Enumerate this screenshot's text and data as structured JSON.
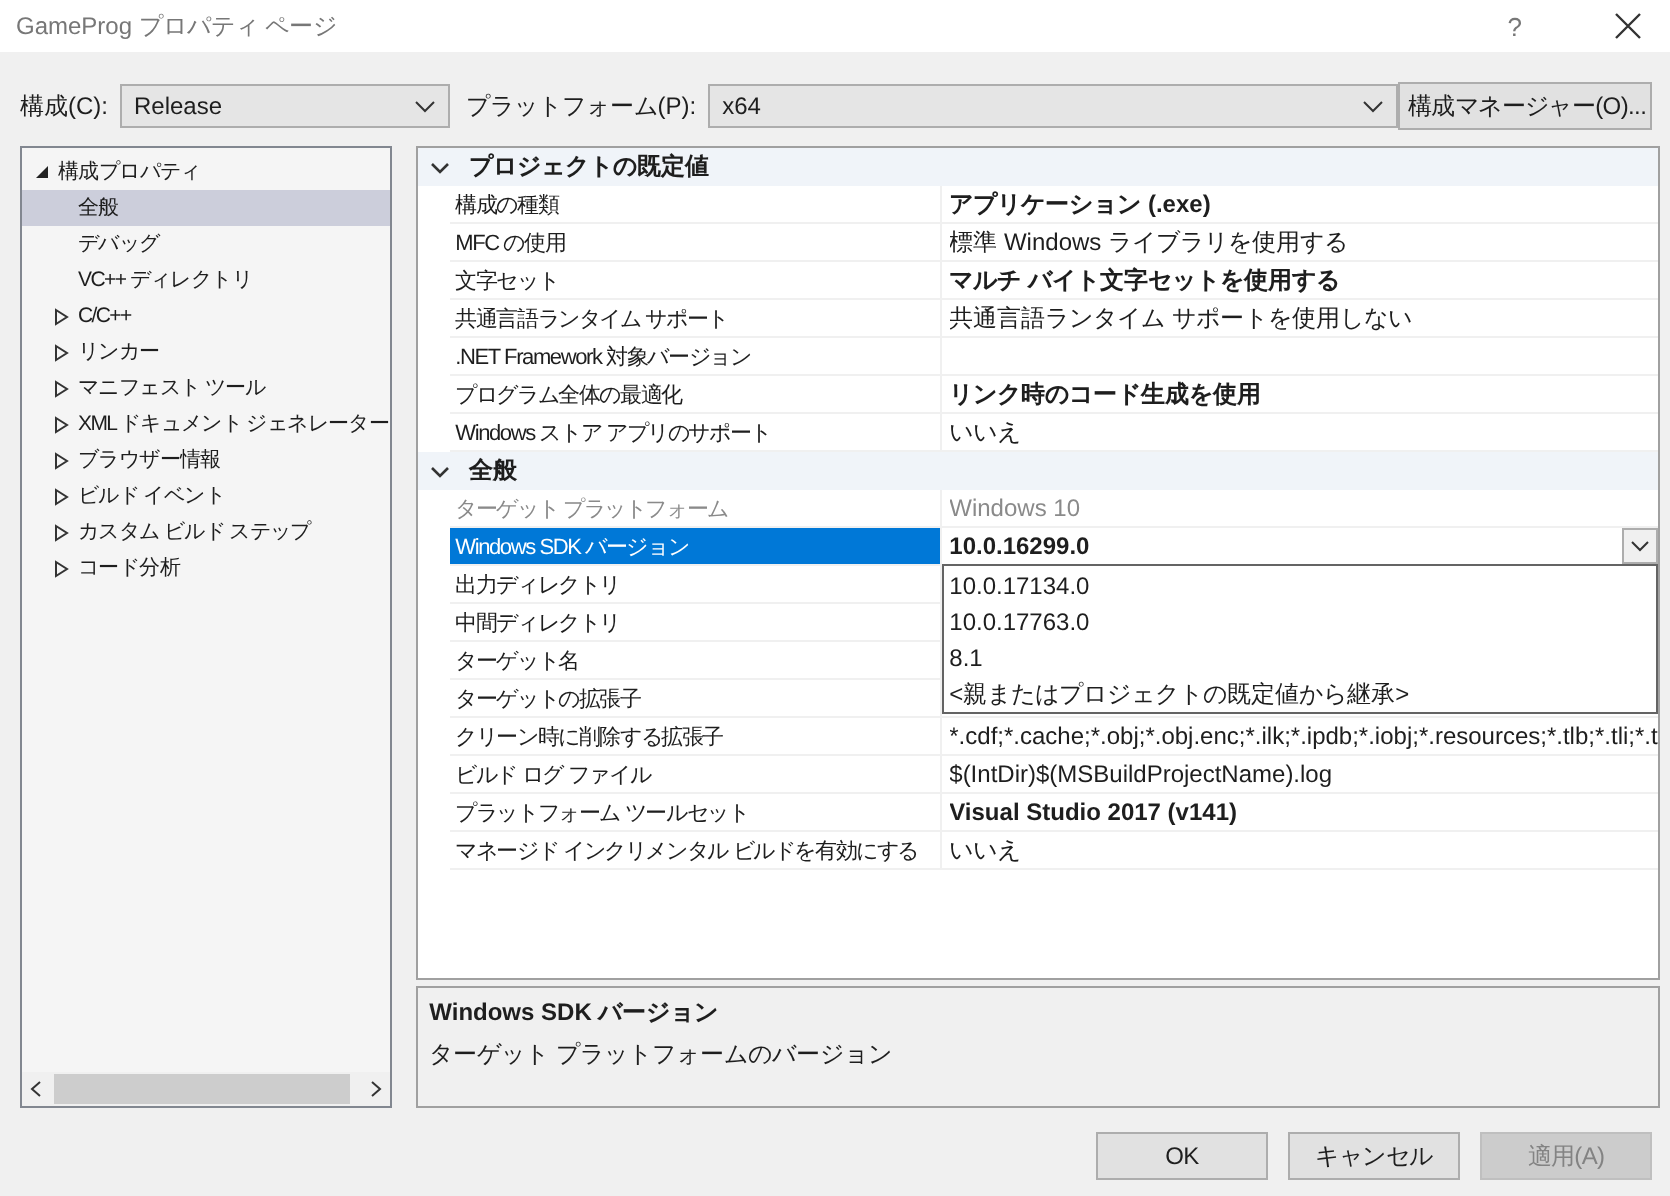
{
  "window": {
    "title": "GameProg プロパティ ページ",
    "help": "?"
  },
  "toolbar": {
    "config_label": "構成(C):",
    "config_value": "Release",
    "platform_label": "プラットフォーム(P):",
    "platform_value": "x64",
    "manager_button": "構成マネージャー(O)..."
  },
  "tree": [
    {
      "label": "構成プロパティ",
      "expanded": true,
      "selected": false,
      "children": [
        {
          "label": "全般",
          "kind": "page",
          "selected": true
        },
        {
          "label": "デバッグ",
          "kind": "page",
          "selected": false
        },
        {
          "label": "VC++ ディレクトリ",
          "kind": "page",
          "selected": false
        },
        {
          "label": "C/C++",
          "kind": "group",
          "selected": false
        },
        {
          "label": "リンカー",
          "kind": "group",
          "selected": false
        },
        {
          "label": "マニフェスト ツール",
          "kind": "group",
          "selected": false
        },
        {
          "label": "XML ドキュメント ジェネレーター",
          "kind": "group",
          "selected": false
        },
        {
          "label": "ブラウザー情報",
          "kind": "group",
          "selected": false
        },
        {
          "label": "ビルド イベント",
          "kind": "group",
          "selected": false
        },
        {
          "label": "カスタム ビルド ステップ",
          "kind": "group",
          "selected": false
        },
        {
          "label": "コード分析",
          "kind": "group",
          "selected": false
        }
      ]
    }
  ],
  "sections": [
    {
      "title": "プロジェクトの既定値",
      "expanded": true,
      "rows": [
        {
          "name": "構成の種類",
          "value": "アプリケーション (.exe)",
          "bold": true,
          "disabled": false,
          "selected": false
        },
        {
          "name": "MFC の使用",
          "value": "標準 Windows ライブラリを使用する",
          "bold": false,
          "disabled": false,
          "selected": false
        },
        {
          "name": "文字セット",
          "value": "マルチ バイト文字セットを使用する",
          "bold": true,
          "disabled": false,
          "selected": false
        },
        {
          "name": "共通言語ランタイム サポート",
          "value": "共通言語ランタイム サポートを使用しない",
          "bold": false,
          "disabled": false,
          "selected": false
        },
        {
          "name": ".NET Framework 対象バージョン",
          "disabled": false,
          "selected": false
        },
        {
          "name": "プログラム全体の最適化",
          "value": "リンク時のコード生成を使用",
          "bold": true,
          "disabled": false,
          "selected": false
        },
        {
          "name": "Windows ストア アプリのサポート",
          "value": "いいえ",
          "bold": false,
          "disabled": false,
          "selected": false
        }
      ]
    },
    {
      "title": "全般",
      "expanded": true,
      "rows": [
        {
          "name": "ターゲット プラットフォーム",
          "value": "Windows 10",
          "bold": false,
          "disabled": true,
          "selected": false
        },
        {
          "name": "Windows SDK バージョン",
          "value": "10.0.16299.0",
          "bold": true,
          "disabled": false,
          "selected": true,
          "options": [
            "10.0.17134.0",
            "10.0.17763.0",
            "8.1",
            "<親またはプロジェクトの既定値から継承>"
          ]
        },
        {
          "name": "出力ディレクトリ",
          "disabled": false,
          "selected": false
        },
        {
          "name": "中間ディレクトリ",
          "disabled": false,
          "selected": false
        },
        {
          "name": "ターゲット名",
          "disabled": false,
          "selected": false
        },
        {
          "name": "ターゲットの拡張子",
          "disabled": false,
          "selected": false
        },
        {
          "name": "クリーン時に削除する拡張子",
          "value": "*.cdf;*.cache;*.obj;*.obj.enc;*.ilk;*.ipdb;*.iobj;*.resources;*.tlb;*.tli;*.t",
          "bold": false,
          "disabled": false,
          "selected": false
        },
        {
          "name": "ビルド ログ ファイル",
          "value": "$(IntDir)$(MSBuildProjectName).log",
          "bold": false,
          "disabled": false,
          "selected": false
        },
        {
          "name": "プラットフォーム ツールセット",
          "value": "Visual Studio 2017 (v141)",
          "bold": true,
          "disabled": false,
          "selected": false
        },
        {
          "name": "マネージド インクリメンタル ビルドを有効にする",
          "value": "いいえ",
          "bold": false,
          "disabled": false,
          "selected": false
        }
      ]
    }
  ],
  "description": {
    "title": "Windows SDK バージョン",
    "text": "ターゲット プラットフォームのバージョン"
  },
  "buttons": [
    {
      "label": "OK",
      "disabled": false
    },
    {
      "label": "キャンセル",
      "disabled": false
    },
    {
      "label": "適用(A)",
      "disabled": true
    }
  ]
}
